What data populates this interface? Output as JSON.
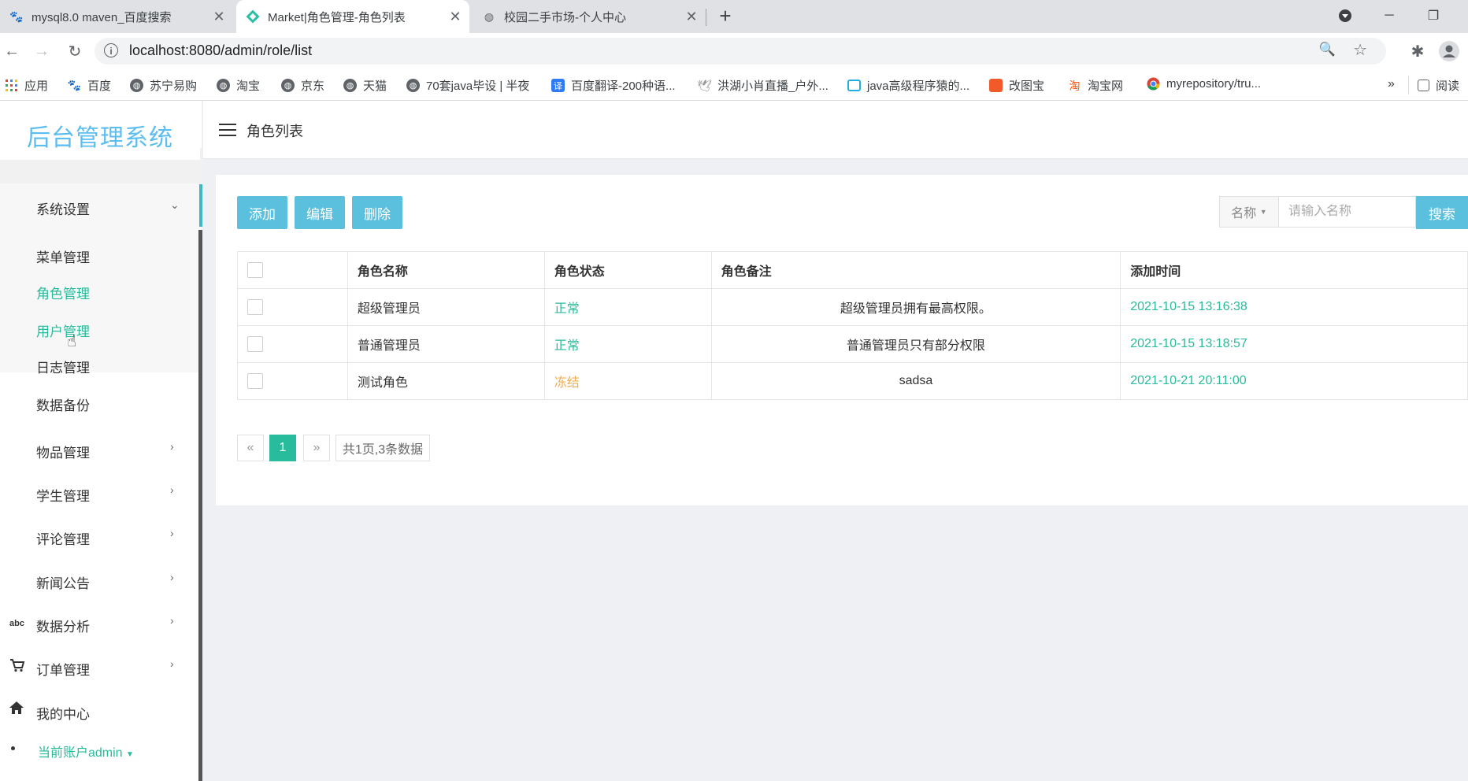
{
  "browser": {
    "tabs": [
      {
        "title": "mysql8.0 maven_百度搜索",
        "icon": "baidu-paw-icon"
      },
      {
        "title": "Market|角色管理-角色列表",
        "icon": "market-diamond-icon"
      },
      {
        "title": "校园二手市场-个人中心",
        "icon": "globe-icon"
      }
    ],
    "new_tab_label": "+",
    "url": "localhost:8080/admin/role/list",
    "bookmarks": [
      {
        "label": "应用",
        "icon": "apps-grid-icon"
      },
      {
        "label": "百度",
        "icon": "baidu-paw-icon"
      },
      {
        "label": "苏宁易购",
        "icon": "globe-icon"
      },
      {
        "label": "淘宝",
        "icon": "globe-icon"
      },
      {
        "label": "京东",
        "icon": "globe-icon"
      },
      {
        "label": "天猫",
        "icon": "globe-icon"
      },
      {
        "label": "70套java毕设 | 半夜",
        "icon": "globe-icon"
      },
      {
        "label": "百度翻译-200种语...",
        "icon": "translate-icon"
      },
      {
        "label": "洪湖小肖直播_户外...",
        "icon": "bird-icon"
      },
      {
        "label": "java高级程序猿的...",
        "icon": "bilibili-icon"
      },
      {
        "label": "改图宝",
        "icon": "image-editor-icon"
      },
      {
        "label": "淘宝网",
        "icon": "taobao-icon"
      },
      {
        "label": "myrepository/tru...",
        "icon": "chrome-icon"
      }
    ],
    "more_bookmarks": "»",
    "reading_list": "阅读"
  },
  "app": {
    "logo": "后台管理系统",
    "page_title": "角色列表",
    "sidebar": {
      "group": "系统设置",
      "sub_items": [
        "菜单管理",
        "角色管理",
        "用户管理",
        "日志管理",
        "数据备份"
      ],
      "items": [
        "物品管理",
        "学生管理",
        "评论管理",
        "新闻公告",
        "数据分析",
        "订单管理",
        "我的中心"
      ],
      "account": "当前账户admin"
    },
    "toolbar": {
      "add": "添加",
      "edit": "编辑",
      "delete": "删除",
      "search_field": "名称",
      "search_placeholder": "请输入名称",
      "search": "搜索"
    },
    "table": {
      "headers": [
        "角色名称",
        "角色状态",
        "角色备注",
        "添加时间"
      ],
      "rows": [
        {
          "name": "超级管理员",
          "status": "正常",
          "remark": "超级管理员拥有最高权限。",
          "time": "2021-10-15 13:16:38"
        },
        {
          "name": "普通管理员",
          "status": "正常",
          "remark": "普通管理员只有部分权限",
          "time": "2021-10-15 13:18:57"
        },
        {
          "name": "测试角色",
          "status": "冻结",
          "remark": "sadsa",
          "time": "2021-10-21 20:11:00"
        }
      ]
    },
    "pagination": {
      "prev": "«",
      "current": "1",
      "next": "»",
      "info": "共1页,3条数据"
    }
  },
  "colors": {
    "accent": "#28bb9c",
    "button": "#5bc0de",
    "logo": "#5bbdf0",
    "frozen": "#f0ad4e"
  }
}
